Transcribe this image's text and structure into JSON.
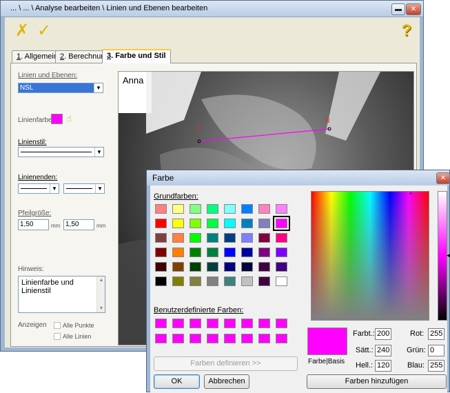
{
  "main": {
    "title": "... \\ ... \\ Analyse bearbeiten \\ Linien und Ebenen bearbeiten",
    "controls": {
      "minimize": "▬",
      "maximize": "□",
      "close": "✕"
    },
    "toolbar": {
      "cancel_icon": "✗",
      "ok_icon": "✓",
      "help_icon": "?"
    },
    "tabs": [
      {
        "key": "1",
        "label": ". Allgemein"
      },
      {
        "key": "2",
        "label": ". Berechnung"
      },
      {
        "key": "3",
        "label": ". Farbe und Stil"
      }
    ],
    "form": {
      "linien_label": "Linien und Ebenen:",
      "linien_value": "NSL",
      "linienfarbe_label": "Linienfarbe:",
      "linienfarbe_color": "#ff00ff",
      "linienstil_label": "Linienstil:",
      "linienenden_label": "Linienenden:",
      "pfeilgroesse_label": "Pfeilgröße:",
      "pfeil1": "1,50",
      "pfeil2": "1,50",
      "unit": "mm",
      "hinweis_label": "Hinweis:",
      "hinweis_text": "Linienfarbe und Linienstil",
      "anzeigen_label": "Anzeigen",
      "alle_punkte": "Alle Punkte",
      "alle_linien": "Alle Linien"
    },
    "image": {
      "name": "Anna",
      "point_s": "S",
      "point_n": "N"
    }
  },
  "dialog": {
    "title": "Farbe",
    "close": "✕",
    "grundfarben_label": "Grundfarben:",
    "basic_colors": [
      "#ff8080",
      "#ffff80",
      "#80ff80",
      "#00ff80",
      "#80ffff",
      "#0080ff",
      "#ff80c0",
      "#ff80ff",
      "#ff0000",
      "#ffff00",
      "#80ff00",
      "#00ff40",
      "#00ffff",
      "#0080c0",
      "#8080c0",
      "#ff00ff",
      "#804040",
      "#ff8040",
      "#00ff00",
      "#008080",
      "#004080",
      "#8080ff",
      "#800040",
      "#ff0080",
      "#800000",
      "#ff8000",
      "#008000",
      "#008040",
      "#0000ff",
      "#0000a0",
      "#800080",
      "#8000ff",
      "#400000",
      "#804000",
      "#004000",
      "#004040",
      "#000080",
      "#000040",
      "#400040",
      "#400080",
      "#000000",
      "#808000",
      "#808040",
      "#808080",
      "#408080",
      "#c0c0c0",
      "#400040",
      "#ffffff"
    ],
    "selected_index": 15,
    "benutzer_label": "Benutzerdefinierte Farben:",
    "custom_colors": [
      "#ff00ff",
      "#ff00ff",
      "#ff00ff",
      "#ff00ff",
      "#ff00ff",
      "#ff00ff",
      "#ff00ff",
      "#ff00ff",
      "#ff00ff",
      "#ff00ff",
      "#ff00ff",
      "#ff00ff",
      "#ff00ff",
      "#ff00ff",
      "#ff00ff",
      "#ff00ff"
    ],
    "define_button": "Farben definieren >>",
    "ok_button": "OK",
    "cancel_button": "Abbrechen",
    "preview_label": "Farbe|Basis",
    "preview_color": "#ff00ff",
    "fields": {
      "farbt_label": "Farbt.:",
      "farbt": "200",
      "saett_label": "Sätt.:",
      "saett": "240",
      "hell_label": "Hell.:",
      "hell": "120",
      "rot_label": "Rot:",
      "rot": "255",
      "gruen_label": "Grün:",
      "gruen": "0",
      "blau_label": "Blau:",
      "blau": "255"
    },
    "add_button": "Farben hinzufügen"
  }
}
